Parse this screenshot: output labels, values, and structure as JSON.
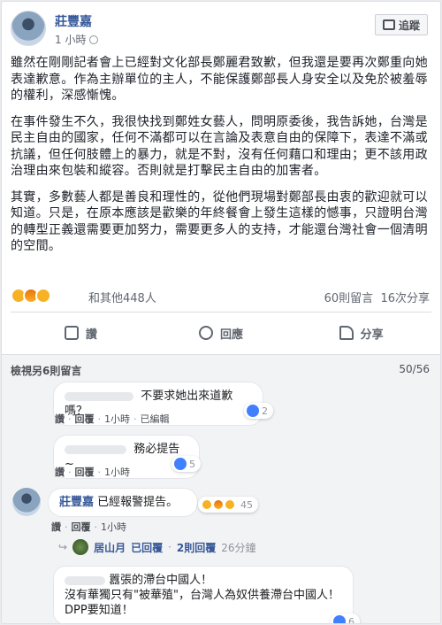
{
  "post": {
    "author": "莊豐嘉",
    "time": "1 小時",
    "follow_label": "追蹤",
    "paragraphs": [
      "雖然在剛剛記者會上已經對文化部長鄭麗君致歉，但我還是要再次鄭重向她表達歉意。作為主辦單位的主人，不能保護鄭部長人身安全以及免於被羞辱的權利，深感慚愧。",
      "在事件發生不久，我很快找到鄭姓女藝人，問明原委後，我告訴她，台灣是民主自由的國家，任何不滿都可以在言論及表意自由的保障下，表達不滿或抗議，但任何肢體上的暴力，就是不對，沒有任何藉口和理由；更不該用政治理由來包裝和縱容。否則就是打擊民主自由的加害者。",
      "其實，多數藝人都是善良和理性的，從他們現場對鄭部長由衷的歡迎就可以知道。只是，在原本應該是歡樂的年終餐會上發生這樣的憾事，只證明台灣的轉型正義還需要更加努力，需要更多人的支持，才能還台灣社會一個清明的空間。"
    ]
  },
  "reactions": {
    "others": "和其他448人",
    "comments": "60則留言",
    "shares": "16次分享"
  },
  "actions": {
    "like": "讚",
    "comment": "回應",
    "share": "分享"
  },
  "comments": {
    "view_more": "檢視另6則留言",
    "count": "50/56",
    "items": [
      {
        "text": "不要求她出來道歉嗎？",
        "likes": "2",
        "links": [
          "讚",
          "回覆",
          "1小時",
          "已編輯"
        ]
      },
      {
        "text": "務必提告~",
        "likes": "5",
        "links": [
          "讚",
          "回覆",
          "1小時"
        ]
      },
      {
        "name": "莊豐嘉",
        "text": "已經報警提告。",
        "reactions": "45",
        "links": [
          "讚",
          "回覆",
          "1小時"
        ]
      }
    ],
    "reply_summary": {
      "name": "居山月",
      "action": "已回覆",
      "count": "2則回覆",
      "time": "26分鐘"
    },
    "last": {
      "line1": "囂張的滯台中國人！",
      "line2": "沒有華獨只有\"被華殖\"，台灣人為奴供養滯台中國人！",
      "line3": "DPP要知道！",
      "likes": "6"
    }
  },
  "colors": {
    "link": "#365899",
    "like_blue": "#4080ff",
    "bg": "#e9ebee"
  }
}
